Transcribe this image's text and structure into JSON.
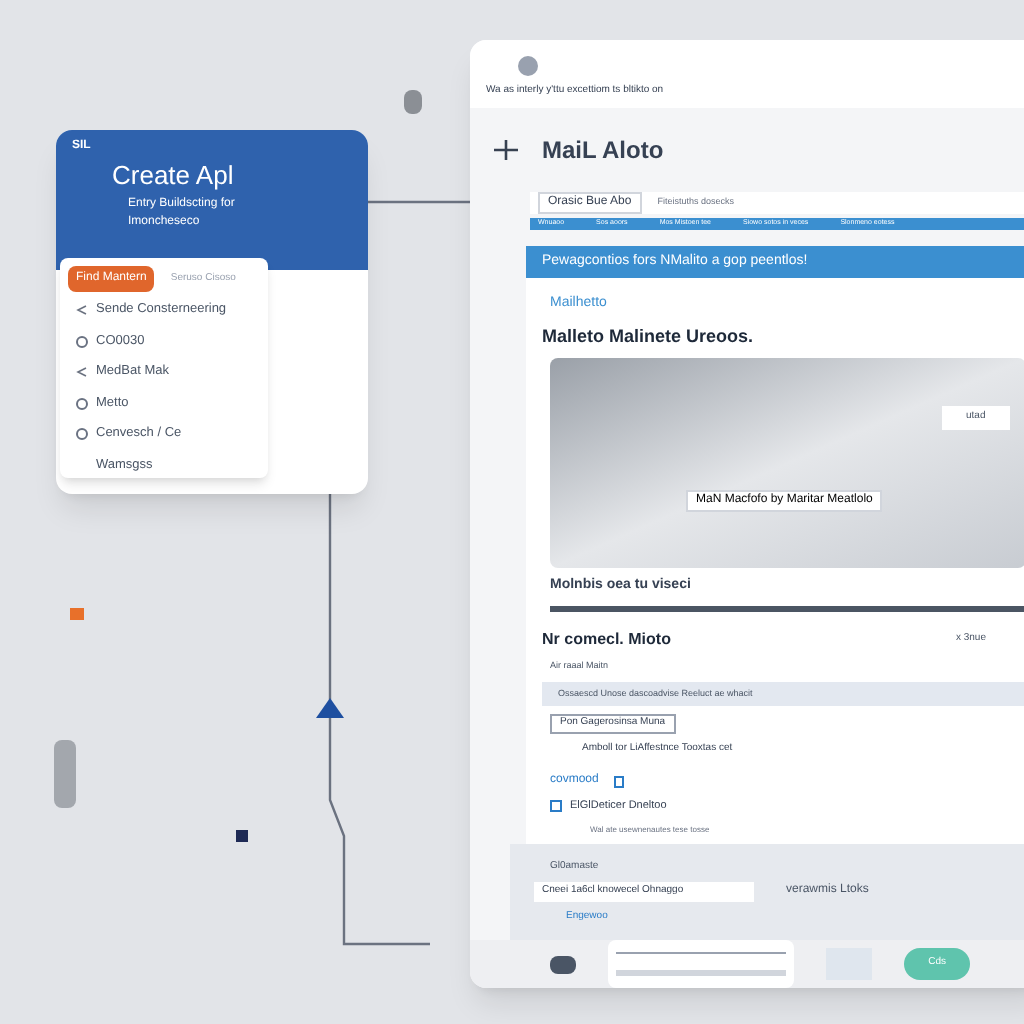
{
  "phone_card": {
    "status": "SIL",
    "title": "Create Apl",
    "subtitle": "Entry Buildscting for",
    "subtitle_2": "Imoncheseco",
    "menu_button": "Find Mantern",
    "menu_note": "Seruso Cisoso",
    "items": [
      {
        "label": "Sende Consterneering",
        "kind": "arrow"
      },
      {
        "label": "CO0030",
        "kind": "radio"
      },
      {
        "label": "MedBat Mak",
        "kind": "arrow"
      },
      {
        "label": "Metto",
        "kind": "radio"
      },
      {
        "label": "Cenvesch / Ce",
        "kind": "radio"
      },
      {
        "label": "Wamsgss",
        "kind": "plain"
      }
    ]
  },
  "window": {
    "address": "Wa as interly y'ttu excettiom ts bltikto on",
    "title": "MaiL Aloto",
    "tab_field": "Orasic Bue Abo",
    "tab_note": "Fiteistuths dosecks",
    "nav": [
      "Wnuaoo",
      "Sos aoors",
      "Mos Mistoen tee",
      "Siowo sotos in veces",
      "Slonmeno eotess"
    ],
    "banner": "Pewagcontios fors NMalito a gop peentlos!",
    "logo": "Mailhetto",
    "heading": "Malleto Malinete Ureoos.",
    "hero_caption": "MaN Macfofo by Maritar Meatlolo",
    "hero_button": "utad",
    "section": "Molnbis oea tu viseci",
    "subheading": "Nr comecl. Mioto",
    "count": "x 3nue",
    "label": "Air raaal Maitn",
    "note": "Ossaescd Unose dascoadvise Reeluct ae whacit",
    "field": "Pon Gagerosinsa Muna",
    "line": "Amboll tor LiAffestnce Tooxtas cet",
    "link": "covmood",
    "checkbox": {
      "label": "ElGlDeticer Dneltoo",
      "checked": false
    },
    "small": "Wal ate usewnenautes tese tosse",
    "panel_label": "Gl0amaste",
    "panel_field": "Cneei 1a6cl knowecel Ohnaggo",
    "panel_text": "verawmis Ltoks",
    "panel_link": "Engewoo",
    "ok_button": "Cds"
  }
}
